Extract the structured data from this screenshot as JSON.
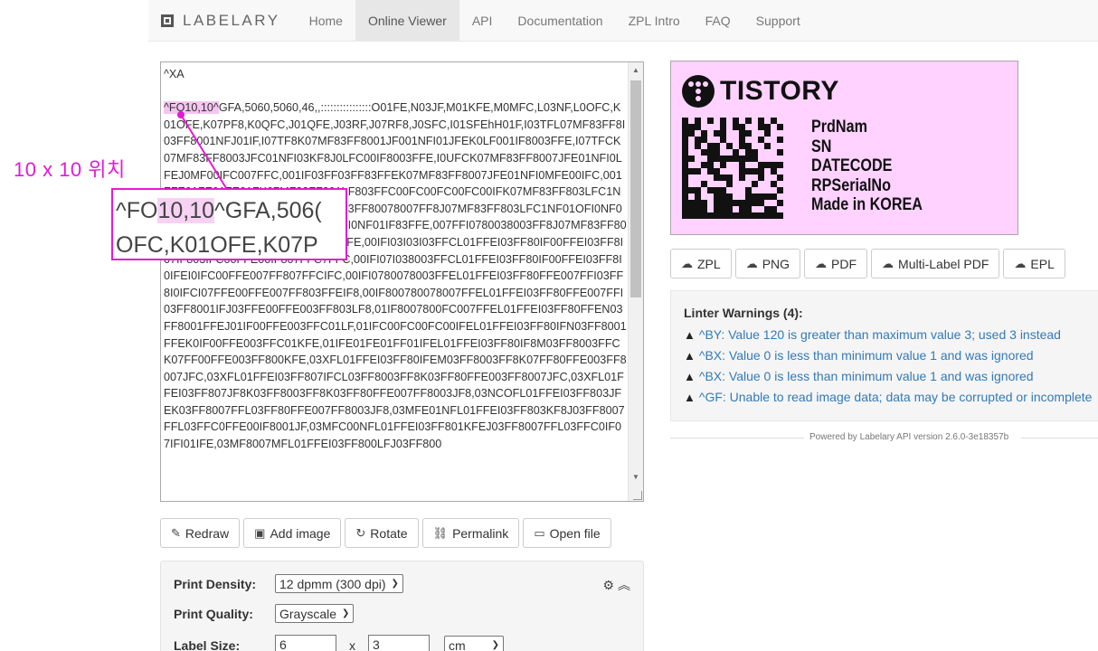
{
  "nav": {
    "brand": "LABELARY",
    "items": [
      "Home",
      "Online Viewer",
      "API",
      "Documentation",
      "ZPL Intro",
      "FAQ",
      "Support"
    ],
    "active_index": 1
  },
  "editor": {
    "line1": "^XA",
    "hl_text": "^FO10,10^",
    "first_line_rest": "GFA,5060,5060,46,,::::::::::::::::O01FE,N03JF,M01KFE,M0MFC,L03NF,L0",
    "body": "OFC,K01OFE,K07PF8,K0QFC,J01QFE,J03RF,J07RF8,J0SFC,I01SFEhH01F,I03TFL07MF83FF8I03FF8001NFJ01IF,I07TF8K07MF83FF8001JF001NFI01JFEK0LF001IF8003FFE,I07TFCK07MF83FF8003JFC01NFI03KF8J0LFC00IF8003FFE,I0UFCK07MF83FF8007JFE01NFI0LFEJ0MF00IFC007FFC,001IF03FF03FF83FFEK07MF83FF8007JFE01NFI0MFE00IFC,001FFE01FE01FE01FK07MF83FF801LF803FFC00FC00FC00FC00IFK07MF83FF803LFC1NF00FC00FC00FC00FC00IFK07MF83FF80078007FF8J07MF83FF803LFC1NF01OFI0NF007FF8J07MF83FF807LFE1NF03OFI0NF01IF83FFE,007FFI0780038003FF8J07MF83FF807FFC3FFE0NF03OF800NF80IF87FFE,00IFI03I03I03FFCL01FFEI03FF80IF00FFEI03FF8I07IF803IFC00FFE00IF807FFC7FFC,00IFI07I038003FFCL01FFEI03FF80IF00FFEI03FF8I0IFEI0IFC00FFE007FF807FFCIFC,00IFI0780078003FFEL01FFEI03FF80FFE007FFI03FF8I0IFCI07FFE00FFE007FF803FFEIF8,00IF800780078007FFEL01FFEI03FF80FFE007FFI03FF8001IFJ03FFE00FFE003FF803LF8,01IF8007800FC007FFEL01FFEI03FF80FFEN03FF8001FFEJ01IF00FFE003FFC01LF,01IFC00FC00FC00IFEL01FFEI03FF80IFN03FF8001FFEK0IF00FFE003FFC01KFE,01IFE01FE01FF01IFEL01FFEI03FF80IF8M03FF8003FFCK07FF00FFE003FF800KFE,03XFL01FFEI03FF80IFEM03FF8003FF8K07FF80FFE003FF8007JFC,03XFL01FFEI03FF807IFCL03FF8003FF8K03FF80FFE003FF8007JFC,03XFL01FFEI03FF807JF8K03FF8003FF8K03FF80FFE007FF8003JF8,03NCOFL01FFEI03FF803JFEK03FF8007FFL03FF80FFE007FF8003JF8,03MFE01NFL01FFEI03FF803KF8J03FF8007FFL03FFC0FFE00IF8001JF,03MFC00NFL01FFEI03FF801KFEJ03FF8007FFL03FFC0IF07IFI01IFE,03MF8007MFL01FFEI03FF800LFJ03FF800"
  },
  "annotation": {
    "label": "10 x 10 위치",
    "zoom_line1_a": "^FO",
    "zoom_line1_b": "10,10",
    "zoom_line1_c": "^GFA,506(",
    "zoom_line2": "OFC,K01OFE,K07P"
  },
  "actions": [
    {
      "icon": "✎",
      "label": "Redraw"
    },
    {
      "icon": "▣",
      "label": "Add image"
    },
    {
      "icon": "↻",
      "label": "Rotate"
    },
    {
      "icon": "⛓",
      "label": "Permalink"
    },
    {
      "icon": "▭",
      "label": "Open file"
    }
  ],
  "settings": {
    "density_label": "Print Density:",
    "density_value": "12 dpmm (300 dpi)",
    "quality_label": "Print Quality:",
    "quality_value": "Grayscale",
    "size_label": "Label Size:",
    "width": "6",
    "x_sep": "x",
    "height": "3",
    "unit": "cm",
    "gear_icons": "⚙ ︽"
  },
  "preview": {
    "brand": "TISTORY",
    "lines": [
      "PrdNam",
      "SN",
      "DATECODE",
      "RPSerialNo",
      "Made in KOREA"
    ],
    "bg_color": "#ffd2ff"
  },
  "downloads": [
    {
      "icon": "☁",
      "label": "ZPL"
    },
    {
      "icon": "☁",
      "label": "PNG"
    },
    {
      "icon": "☁",
      "label": "PDF"
    },
    {
      "icon": "☁",
      "label": "Multi-Label PDF"
    },
    {
      "icon": "☁",
      "label": "EPL"
    }
  ],
  "linter": {
    "title": "Linter Warnings (4):",
    "warnings": [
      "^BY: Value 120 is greater than maximum value 3; used 3 instead",
      "^BX: Value 0 is less than minimum value 1 and was ignored",
      "^BX: Value 0 is less than minimum value 1 and was ignored",
      "^GF: Unable to read image data; data may be corrupted or incomplete"
    ]
  },
  "footer": {
    "powered": "Powered by Labelary API version 2.6.0-3e18357b"
  },
  "colors": {
    "annotation": "#e21bd5",
    "link": "#337ab7"
  }
}
